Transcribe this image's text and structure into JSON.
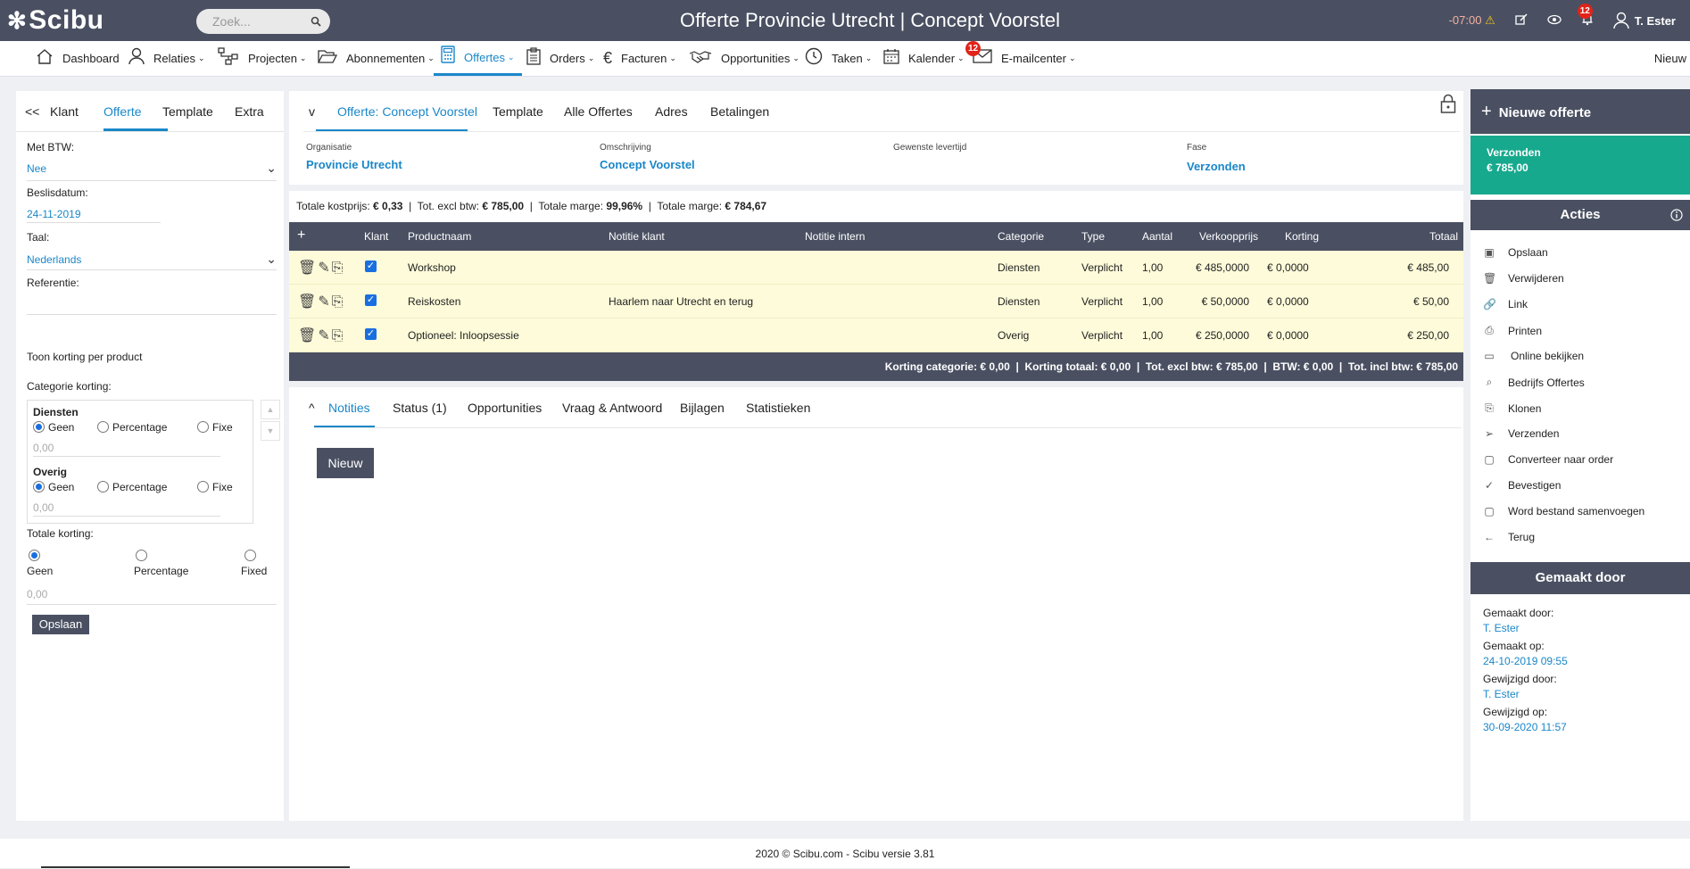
{
  "app": {
    "logo": "Scibu",
    "title": "Offerte Provincie Utrecht | Concept Voorstel"
  },
  "topbar": {
    "search_placeholder": "Zoek...",
    "time": "-07:00",
    "notifications_count": "12",
    "user": "T. Ester"
  },
  "nav": {
    "items": [
      {
        "label": "Dashboard"
      },
      {
        "label": "Relaties"
      },
      {
        "label": "Projecten"
      },
      {
        "label": "Abonnementen"
      },
      {
        "label": "Offertes"
      },
      {
        "label": "Orders"
      },
      {
        "label": "Facturen"
      },
      {
        "label": "Opportunities"
      },
      {
        "label": "Taken"
      },
      {
        "label": "Kalender"
      },
      {
        "label": "E-mailcenter"
      }
    ],
    "email_badge": "12",
    "new_label": "Nieuw"
  },
  "left": {
    "collapse": "<<",
    "tabs": [
      "Klant",
      "Offerte",
      "Template",
      "Extra"
    ],
    "btw_label": "Met BTW:",
    "btw_value": "Nee",
    "beslis_label": "Beslisdatum:",
    "beslis_value": "24-11-2019",
    "taal_label": "Taal:",
    "taal_value": "Nederlands",
    "ref_label": "Referentie:",
    "toon_korting": "Toon korting per product",
    "cat_korting_label": "Categorie korting:",
    "categories": [
      {
        "name": "Diensten",
        "opt1": "Geen",
        "opt2": "Percentage",
        "opt3": "Fixe",
        "value": "0,00"
      },
      {
        "name": "Overig",
        "opt1": "Geen",
        "opt2": "Percentage",
        "opt3": "Fixe",
        "value": "0,00"
      }
    ],
    "totale_korting_label": "Totale korting:",
    "totale_opts": [
      "Geen",
      "Percentage",
      "Fixed"
    ],
    "totale_value": "0,00",
    "save": "Opslaan"
  },
  "center": {
    "collapse": "v",
    "tabs": [
      "Offerte: Concept Voorstel",
      "Template",
      "Alle Offertes",
      "Adres",
      "Betalingen"
    ],
    "fields": [
      {
        "label": "Organisatie",
        "value": "Provincie Utrecht"
      },
      {
        "label": "Omschrijving",
        "value": "Concept Voorstel"
      },
      {
        "label": "Gewenste levertijd",
        "value": ""
      },
      {
        "label": "Fase",
        "value": "Verzonden"
      }
    ]
  },
  "totals": {
    "kostprijs_label": "Totale kostprijs:",
    "kostprijs": "€ 0,33",
    "excl_label": "Tot. excl btw:",
    "excl": "€ 785,00",
    "marge_pct_label": "Totale marge:",
    "marge_pct": "99,96%",
    "marge_label": "Totale marge:",
    "marge": "€ 784,67"
  },
  "table": {
    "add": "+",
    "headers": {
      "klant": "Klant",
      "product": "Productnaam",
      "notitie_klant": "Notitie klant",
      "notitie_intern": "Notitie intern",
      "categorie": "Categorie",
      "type": "Type",
      "aantal": "Aantal",
      "verkoopprijs": "Verkoopprijs",
      "korting": "Korting",
      "totaal": "Totaal"
    },
    "rows": [
      {
        "product": "Workshop",
        "notitie_klant": "",
        "notitie_intern": "",
        "categorie": "Diensten",
        "type": "Verplicht",
        "aantal": "1,00",
        "verkoopprijs": "€ 485,0000",
        "korting": "€ 0,0000",
        "totaal": "€ 485,00"
      },
      {
        "product": "Reiskosten",
        "notitie_klant": "Haarlem naar Utrecht en terug",
        "notitie_intern": "",
        "categorie": "Diensten",
        "type": "Verplicht",
        "aantal": "1,00",
        "verkoopprijs": "€ 50,0000",
        "korting": "€ 0,0000",
        "totaal": "€ 50,00"
      },
      {
        "product": "Optioneel: Inloopsessie",
        "notitie_klant": "",
        "notitie_intern": "",
        "categorie": "Overig",
        "type": "Verplicht",
        "aantal": "1,00",
        "verkoopprijs": "€ 250,0000",
        "korting": "€ 0,0000",
        "totaal": "€ 250,00"
      }
    ],
    "footer": "Korting categorie: € 0,00  |  Korting totaal: € 0,00  |  Tot. excl btw: € 785,00  |  BTW: € 0,00  |  Tot. incl btw: € 785,00"
  },
  "bottom": {
    "collapse": "^",
    "tabs": [
      "Notities",
      "Status (1)",
      "Opportunities",
      "Vraag & Antwoord",
      "Bijlagen",
      "Statistieken"
    ],
    "new_button": "Nieuw"
  },
  "right": {
    "new_offer": "Nieuwe offerte",
    "status_label": "Verzonden",
    "status_amount": "€ 785,00",
    "acties_title": "Acties",
    "actions": [
      "Opslaan",
      "Verwijderen",
      "Link",
      "Printen",
      "Online bekijken",
      "Bedrijfs Offertes",
      "Klonen",
      "Verzenden",
      "Converteer naar order",
      "Bevestigen",
      "Word bestand samenvoegen",
      "Terug"
    ],
    "gemaakt_title": "Gemaakt door",
    "gemaakt_door_label": "Gemaakt door:",
    "gemaakt_door": "T. Ester",
    "gemaakt_op_label": "Gemaakt op:",
    "gemaakt_op": "24-10-2019 09:55",
    "gewijzigd_door_label": "Gewijzigd door:",
    "gewijzigd_door": "T. Ester",
    "gewijzigd_op_label": "Gewijzigd op:",
    "gewijzigd_op": "30-09-2020 11:57"
  },
  "footer": {
    "text": "2020 © Scibu.com - Scibu versie 3.81"
  }
}
